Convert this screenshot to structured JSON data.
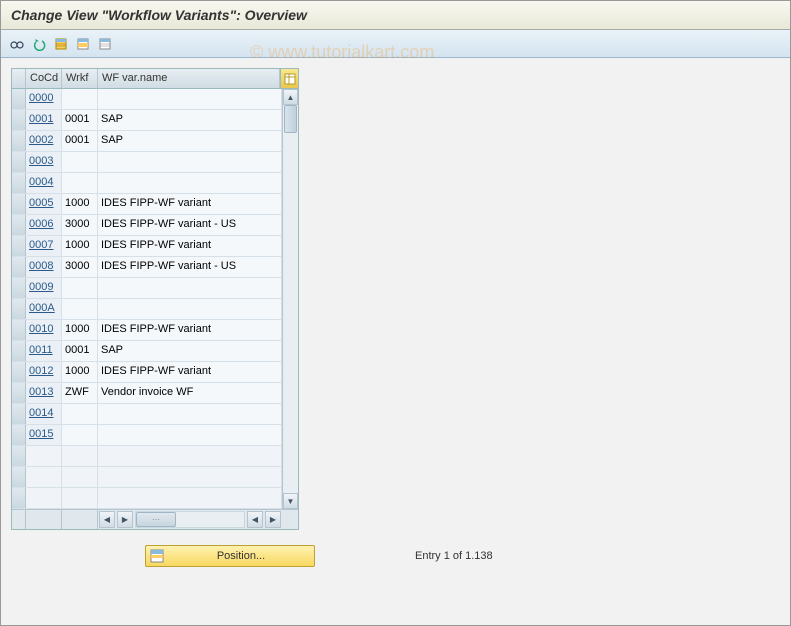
{
  "title": "Change View \"Workflow Variants\": Overview",
  "watermark": "© www.tutorialkart.com",
  "columns": {
    "cocd": "CoCd",
    "wrkf": "Wrkf",
    "name": "WF var.name"
  },
  "rows": [
    {
      "cocd": "0000",
      "wrkf": "",
      "name": ""
    },
    {
      "cocd": "0001",
      "wrkf": "0001",
      "name": "SAP"
    },
    {
      "cocd": "0002",
      "wrkf": "0001",
      "name": "SAP"
    },
    {
      "cocd": "0003",
      "wrkf": "",
      "name": ""
    },
    {
      "cocd": "0004",
      "wrkf": "",
      "name": ""
    },
    {
      "cocd": "0005",
      "wrkf": "1000",
      "name": "IDES FIPP-WF variant"
    },
    {
      "cocd": "0006",
      "wrkf": "3000",
      "name": "IDES FIPP-WF variant - US"
    },
    {
      "cocd": "0007",
      "wrkf": "1000",
      "name": "IDES FIPP-WF variant"
    },
    {
      "cocd": "0008",
      "wrkf": "3000",
      "name": "IDES FIPP-WF variant - US"
    },
    {
      "cocd": "0009",
      "wrkf": "",
      "name": ""
    },
    {
      "cocd": "000A",
      "wrkf": "",
      "name": ""
    },
    {
      "cocd": "0010",
      "wrkf": "1000",
      "name": "IDES FIPP-WF variant"
    },
    {
      "cocd": "0011",
      "wrkf": "0001",
      "name": "SAP"
    },
    {
      "cocd": "0012",
      "wrkf": "1000",
      "name": "IDES FIPP-WF variant"
    },
    {
      "cocd": "0013",
      "wrkf": "ZWF",
      "name": "Vendor invoice WF"
    },
    {
      "cocd": "0014",
      "wrkf": "",
      "name": ""
    },
    {
      "cocd": "0015",
      "wrkf": "",
      "name": ""
    }
  ],
  "blank_rows": 3,
  "position_button": "Position...",
  "entry_status": "Entry 1 of 1.138",
  "toolbar_icons": [
    "change-icon",
    "undo-icon",
    "select-all-icon",
    "select-block-icon",
    "deselect-all-icon"
  ]
}
